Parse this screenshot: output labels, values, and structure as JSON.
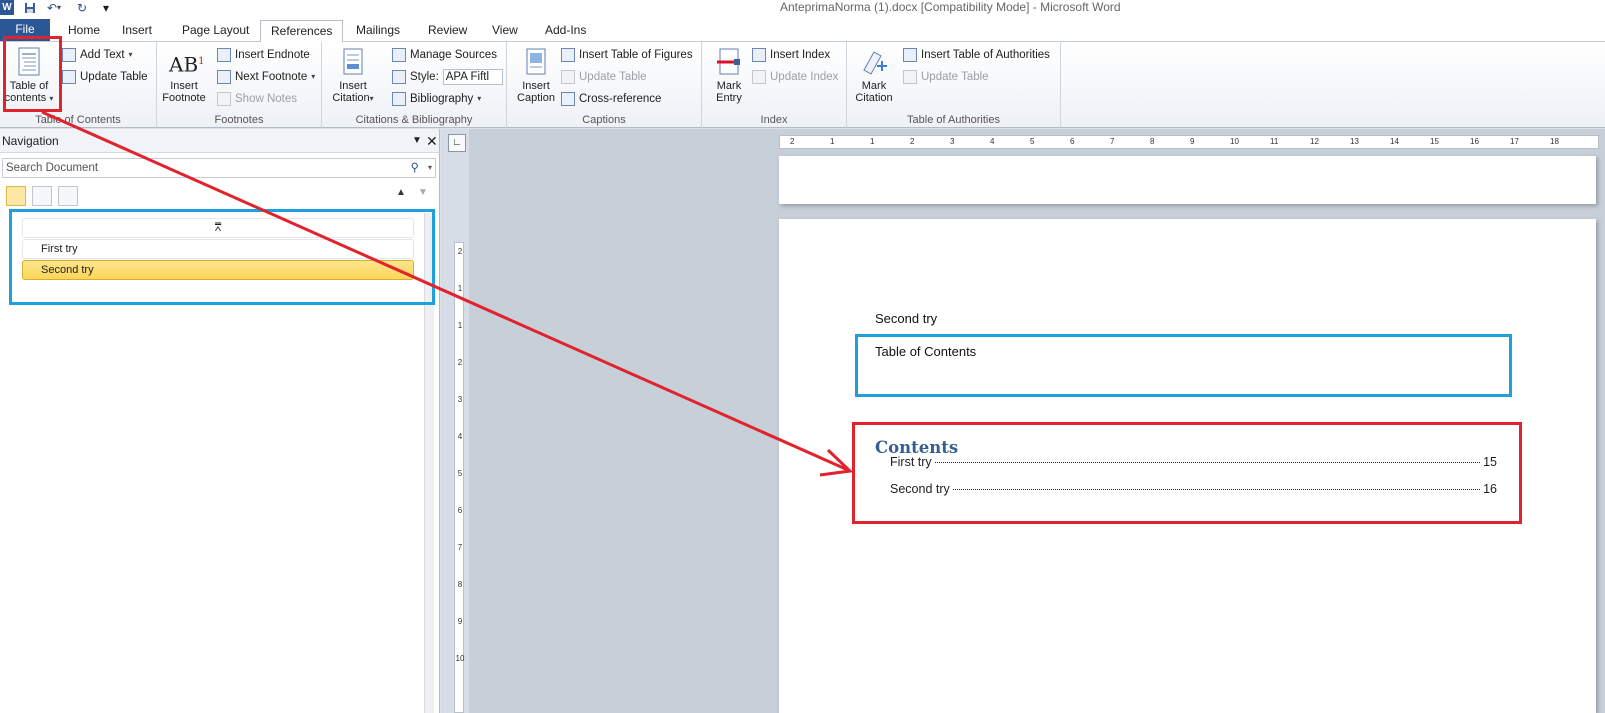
{
  "window": {
    "title": "AnteprimaNorma (1).docx [Compatibility Mode]  -  Microsoft Word"
  },
  "quick_access": {
    "undo_icon": "undo-icon",
    "redo_icon": "redo-icon",
    "save_icon": "save-icon"
  },
  "tabs": [
    {
      "label": "File"
    },
    {
      "label": "Home"
    },
    {
      "label": "Insert"
    },
    {
      "label": "Page Layout"
    },
    {
      "label": "References"
    },
    {
      "label": "Mailings"
    },
    {
      "label": "Review"
    },
    {
      "label": "View"
    },
    {
      "label": "Add-Ins"
    }
  ],
  "ribbon": {
    "toc_group": {
      "label": "Table of Contents",
      "toc_button": "Table of\ncontents",
      "toc_line1": "Table of",
      "toc_line2": "contents",
      "add_text": "Add Text",
      "update_table": "Update Table"
    },
    "footnotes_group": {
      "label": "Footnotes",
      "insert_footnote_line1": "Insert",
      "insert_footnote_line2": "Footnote",
      "insert_endnote": "Insert Endnote",
      "next_footnote": "Next Footnote",
      "show_notes": "Show Notes"
    },
    "citations_group": {
      "label": "Citations & Bibliography",
      "insert_citation_line1": "Insert",
      "insert_citation_line2": "Citation",
      "manage_sources": "Manage Sources",
      "style_label": "Style:",
      "style_value": "APA Fiftl",
      "bibliography": "Bibliography"
    },
    "captions_group": {
      "label": "Captions",
      "insert_caption_line1": "Insert",
      "insert_caption_line2": "Caption",
      "insert_table_of_figures": "Insert Table of Figures",
      "update_table": "Update Table",
      "cross_reference": "Cross-reference"
    },
    "index_group": {
      "label": "Index",
      "mark_entry_line1": "Mark",
      "mark_entry_line2": "Entry",
      "insert_index": "Insert Index",
      "update_index": "Update Index"
    },
    "authorities_group": {
      "label": "Table of Authorities",
      "mark_citation_line1": "Mark",
      "mark_citation_line2": "Citation",
      "insert_table_of_authorities": "Insert Table of Authorities",
      "update_table": "Update Table"
    }
  },
  "navigation": {
    "title": "Navigation",
    "search_placeholder": "Search Document",
    "items": [
      {
        "label": "First try",
        "selected": false
      },
      {
        "label": "Second try",
        "selected": true
      }
    ]
  },
  "ruler": {
    "h_ticks": [
      "2",
      "1",
      "1",
      "2",
      "3",
      "4",
      "5",
      "6",
      "7",
      "8",
      "9",
      "10",
      "11",
      "12",
      "13",
      "14",
      "15",
      "16",
      "17",
      "18"
    ],
    "v_ticks": [
      "2",
      "1",
      "1",
      "2",
      "3",
      "4",
      "5",
      "6",
      "7",
      "8",
      "9",
      "10"
    ]
  },
  "document": {
    "heading_text": "Second try",
    "toc_placeholder": "Table of Contents",
    "toc_title": "Contents",
    "toc_entries": [
      {
        "label": "First try",
        "page": "15"
      },
      {
        "label": "Second try",
        "page": "16"
      }
    ]
  },
  "colors": {
    "annotation_red": "#e0232d",
    "annotation_blue": "#1ea0dd",
    "file_tab": "#2b5797",
    "toc_heading": "#365f91",
    "nav_selected": "#fcd657"
  }
}
